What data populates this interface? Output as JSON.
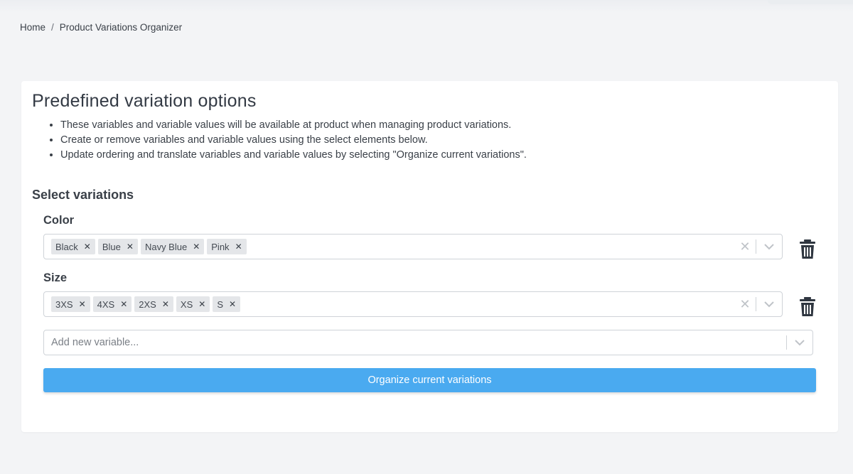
{
  "breadcrumb": {
    "home": "Home",
    "separator": "/",
    "current": "Product Variations Organizer"
  },
  "card": {
    "title": "Predefined variation options",
    "bullets": [
      "These variables and variable values will be available at product when managing product variations.",
      "Create or remove variables and variable values using the select elements below.",
      "Update ordering and translate variables and variable values by selecting \"Organize current variations\"."
    ],
    "section_title": "Select variations"
  },
  "variables": [
    {
      "label": "Color",
      "values": [
        "Black",
        "Blue",
        "Navy Blue",
        "Pink"
      ]
    },
    {
      "label": "Size",
      "values": [
        "3XS",
        "4XS",
        "2XS",
        "XS",
        "S"
      ]
    }
  ],
  "add_variable": {
    "placeholder": "Add new variable..."
  },
  "organize_button": {
    "label": "Organize current variations"
  },
  "icons": {
    "chip_remove": "close-icon",
    "clear": "clear-icon",
    "dropdown": "chevron-down-icon",
    "delete": "trash-icon"
  },
  "colors": {
    "primary": "#4aaaf0",
    "chip_bg": "#e4e6e9",
    "page_bg": "#f3f4f6"
  }
}
